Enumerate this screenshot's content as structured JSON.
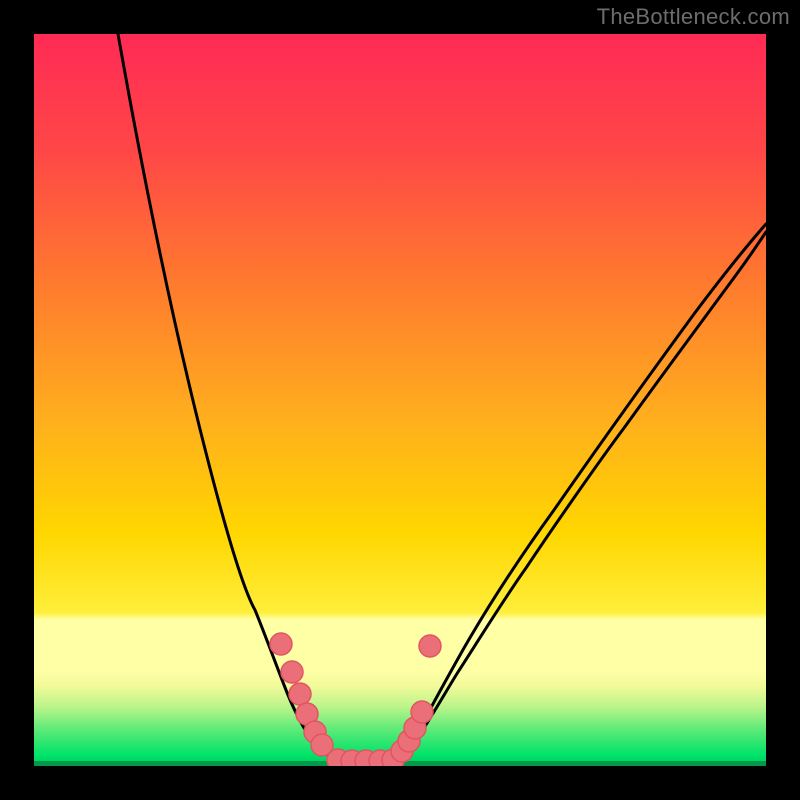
{
  "watermark": "TheBottleneck.com",
  "chart_data": {
    "type": "line",
    "title": "",
    "xlabel": "",
    "ylabel": "",
    "xlim": [
      0,
      100
    ],
    "ylim": [
      0,
      100
    ],
    "series": [
      {
        "name": "left-curve",
        "x_svg": [
          84,
          110,
          140,
          170,
          200,
          221,
          239,
          254,
          266,
          275,
          282,
          289,
          296,
          304,
          315
        ],
        "y_svg": [
          0,
          147,
          293,
          411,
          511,
          576,
          626,
          661,
          685,
          701,
          711,
          718,
          723,
          726,
          728
        ]
      },
      {
        "name": "right-curve",
        "x_svg": [
          360,
          366,
          374,
          386,
          402,
          424,
          454,
          492,
          538,
          590,
          646,
          702,
          732
        ],
        "y_svg": [
          728,
          723,
          714,
          700,
          679,
          648,
          607,
          554,
          489,
          414,
          331,
          243,
          193
        ]
      },
      {
        "name": "dots-left",
        "marker": "circle",
        "points_svg": [
          [
            247,
            610
          ],
          [
            258,
            638
          ],
          [
            266,
            660
          ],
          [
            273,
            680
          ],
          [
            281,
            698
          ],
          [
            288,
            711
          ]
        ]
      },
      {
        "name": "dots-bottom",
        "marker": "circle",
        "points_svg": [
          [
            304,
            726
          ],
          [
            318,
            727
          ],
          [
            332,
            727
          ],
          [
            346,
            727
          ],
          [
            359,
            726
          ]
        ]
      },
      {
        "name": "dots-right",
        "marker": "circle",
        "points_svg": [
          [
            368,
            717
          ],
          [
            375,
            707
          ],
          [
            381,
            694
          ],
          [
            388,
            678
          ],
          [
            396,
            612
          ]
        ]
      }
    ],
    "colors": {
      "curve": "#000000",
      "dot_fill": "#eb6f78",
      "dot_stroke": "#e15561",
      "bg_top": "#ff2a55",
      "bg_mid1": "#ff7a2e",
      "bg_mid2": "#ffd600",
      "bg_band_pale": "#ffffa6",
      "bg_green": "#00e36a"
    }
  }
}
